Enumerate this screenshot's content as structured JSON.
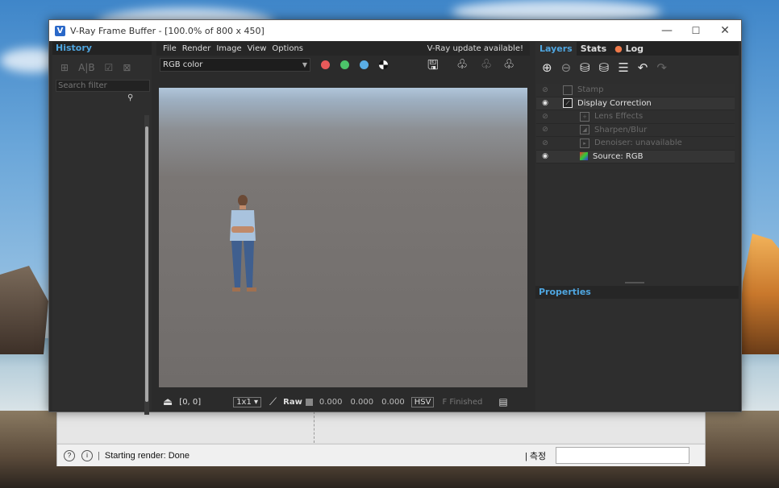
{
  "window": {
    "title": "V-Ray Frame Buffer - [100.0% of 800 x 450]",
    "minimize": "—",
    "maximize": "☐",
    "close": "✕"
  },
  "history": {
    "tab": "History",
    "search_placeholder": "Search filter"
  },
  "menubar": {
    "items": [
      "File",
      "Render",
      "Image",
      "View",
      "Options"
    ],
    "update_notice": "V-Ray update available!"
  },
  "toolbar": {
    "channel": "RGB color",
    "colors": {
      "red": "#e85a5a",
      "green": "#4cc46a",
      "blue": "#5aaee6"
    }
  },
  "bottombar": {
    "coords": "[0, 0]",
    "zoom": "1x1",
    "raw_label": "Raw",
    "values": [
      "0.000",
      "0.000",
      "0.000"
    ],
    "mode": "HSV",
    "status": "F Finished"
  },
  "layers": {
    "tabs": [
      "Layers",
      "Stats",
      "Log"
    ],
    "items": [
      {
        "label": "Stamp",
        "enabled": false
      },
      {
        "label": "Display Correction",
        "enabled": true
      },
      {
        "label": "Lens Effects",
        "enabled": false
      },
      {
        "label": "Sharpen/Blur",
        "enabled": false
      },
      {
        "label": "Denoiser: unavailable",
        "enabled": false
      },
      {
        "label": "Source: RGB",
        "enabled": true
      }
    ],
    "properties_title": "Properties"
  },
  "statusbar": {
    "message": "Starting render: Done",
    "measure_label": "측정"
  }
}
